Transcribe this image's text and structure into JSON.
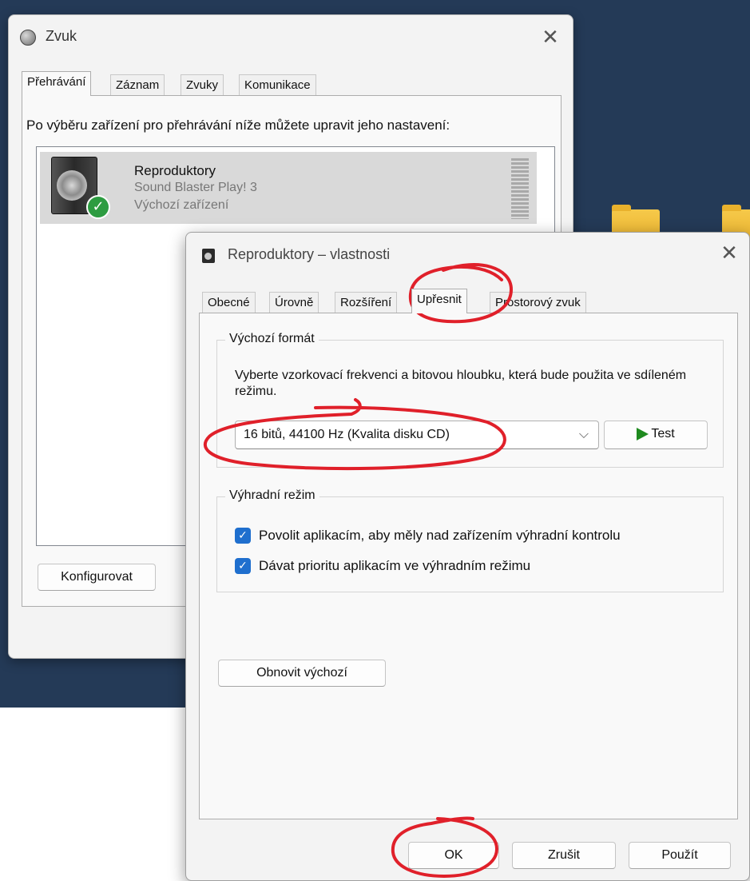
{
  "desktop": {},
  "zvuk_window": {
    "title": "Zvuk",
    "close_glyph": "✕",
    "tabs": [
      {
        "label": "Přehrávání",
        "active": true
      },
      {
        "label": "Záznam",
        "active": false
      },
      {
        "label": "Zvuky",
        "active": false
      },
      {
        "label": "Komunikace",
        "active": false
      }
    ],
    "intro_text": "Po výběru zařízení pro přehrávání níže můžete upravit jeho nastavení:",
    "device": {
      "name": "Reproduktory",
      "subtitle": "Sound Blaster Play! 3",
      "status": "Výchozí zařízení",
      "icon": "speaker-icon",
      "badge_icon": "check-badge-icon",
      "badge_glyph": "✓"
    },
    "configure_button": "Konfigurovat"
  },
  "properties_dialog": {
    "title": "Reproduktory – vlastnosti",
    "close_glyph": "✕",
    "tabs": [
      {
        "label": "Obecné",
        "active": false
      },
      {
        "label": "Úrovně",
        "active": false
      },
      {
        "label": "Rozšíření",
        "active": false
      },
      {
        "label": "Upřesnit",
        "active": true
      },
      {
        "label": "Prostorový zvuk",
        "active": false
      }
    ],
    "default_format": {
      "legend": "Výchozí formát",
      "description": "Vyberte vzorkovací frekvenci a bitovou hloubku, která bude použita ve sdíleném režimu.",
      "selected_value": "16 bitů, 44100 Hz (Kvalita disku CD)",
      "chevron_glyph": "⌵",
      "test_button": "Test"
    },
    "exclusive_mode": {
      "legend": "Výhradní režim",
      "checkbox_glyph": "✓",
      "options": [
        {
          "label": "Povolit aplikacím, aby měly nad zařízením výhradní kontrolu",
          "checked": true
        },
        {
          "label": "Dávat prioritu aplikacím ve výhradním režimu",
          "checked": true
        }
      ]
    },
    "restore_button": "Obnovit výchozí",
    "ok_button": "OK",
    "cancel_button": "Zrušit",
    "apply_button": "Použít"
  },
  "colors": {
    "desktop_bg": "#243a57",
    "annotation_red": "#e0202a",
    "checkbox_blue": "#1f6fce",
    "play_green": "#1f8a1f",
    "default_check_green": "#2d9c41"
  }
}
